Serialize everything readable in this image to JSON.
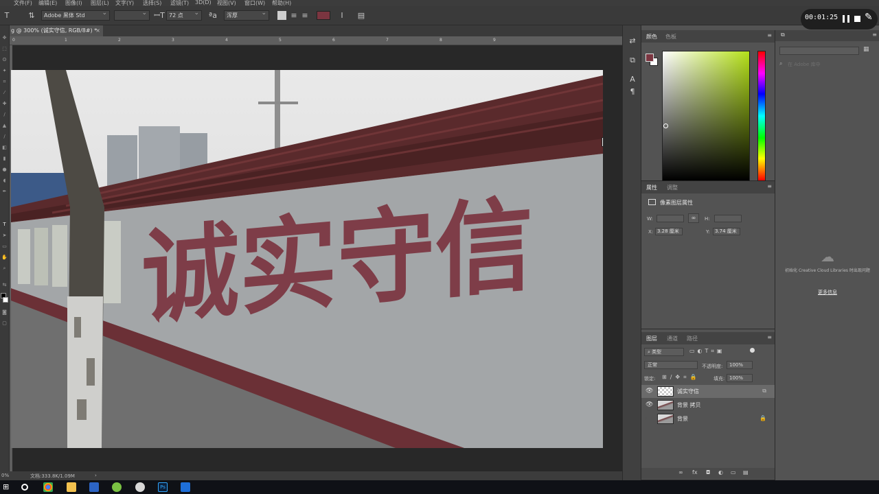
{
  "menu": [
    "文件(F)",
    "编辑(E)",
    "图像(I)",
    "图层(L)",
    "文字(Y)",
    "选择(S)",
    "滤镜(T)",
    "3D(D)",
    "视图(V)",
    "窗口(W)",
    "帮助(H)"
  ],
  "options_bar": {
    "font_family": "Adobe 黑体 Std",
    "font_size": "72 点",
    "antialias": "浑厚",
    "text_color": "#7b3540"
  },
  "recorder": {
    "time": "00:01:25"
  },
  "document": {
    "tab_title": "g @ 300% (诚实守信, RGB/8#) *",
    "close": "×"
  },
  "ruler_ticks": [
    "0",
    "1",
    "2",
    "3",
    "4",
    "5",
    "6",
    "7",
    "8",
    "9"
  ],
  "status": {
    "zoom": "0%",
    "doc_size": "文档:333.8K/1.09M",
    "arrow": "›"
  },
  "artwork": {
    "slogan": "诚实守信",
    "slogan_color": "#7b3540"
  },
  "color_panel": {
    "tabs": [
      "颜色",
      "色板"
    ],
    "foreground": "#7b3540",
    "background": "#ffffff"
  },
  "properties_panel": {
    "tabs": [
      "属性",
      "调整"
    ],
    "title": "像素图层属性",
    "w_label": "W:",
    "h_label": "H:",
    "link_icon": "∞",
    "x_label": "X:",
    "x_value": "3.28 厘米",
    "y_label": "Y:",
    "y_value": "3.74 厘米"
  },
  "layers_panel": {
    "tabs": [
      "图层",
      "通道",
      "路径"
    ],
    "filter_label": "类型",
    "blend_mode": "正常",
    "opacity_label": "不透明度:",
    "opacity_value": "100%",
    "lock_label": "锁定:",
    "fill_label": "填充:",
    "fill_value": "100%",
    "layers": [
      {
        "name": "诚实守信",
        "visible": true,
        "selected": true
      },
      {
        "name": "背景 拷贝",
        "visible": true,
        "selected": false
      },
      {
        "name": "背景",
        "visible": false,
        "selected": false
      }
    ],
    "bottom_icons": [
      "∞",
      "fx",
      "◘",
      "◐",
      "▭",
      "▤"
    ]
  },
  "library_panel": {
    "search_placeholder": "在 Adobe 库中",
    "message": "初始化 Creative Cloud Libraries 时出现问题",
    "link": "更多信息"
  }
}
